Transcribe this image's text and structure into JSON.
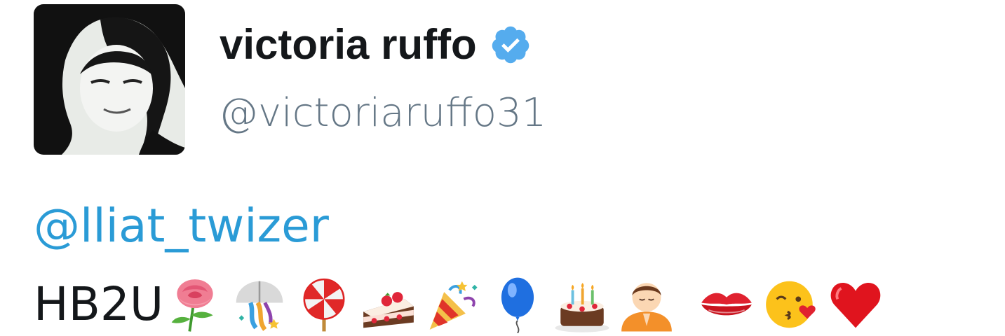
{
  "tweet": {
    "author": {
      "display_name": "victoria ruffo",
      "handle": "@victoriaruffo31",
      "verified": true,
      "verified_color": "#55acee"
    },
    "mention": "@lliat_twizer",
    "text": "HB2U",
    "emojis": [
      "rose",
      "confetti-ball",
      "lollipop",
      "shortcake",
      "party-popper",
      "balloon",
      "birthday-cake",
      "person-praying",
      "kiss-mark",
      "kissing-face-with-heart",
      "red-heart"
    ]
  },
  "colors": {
    "name": "#14171a",
    "handle": "#657786",
    "mention": "#2a9bd6"
  }
}
